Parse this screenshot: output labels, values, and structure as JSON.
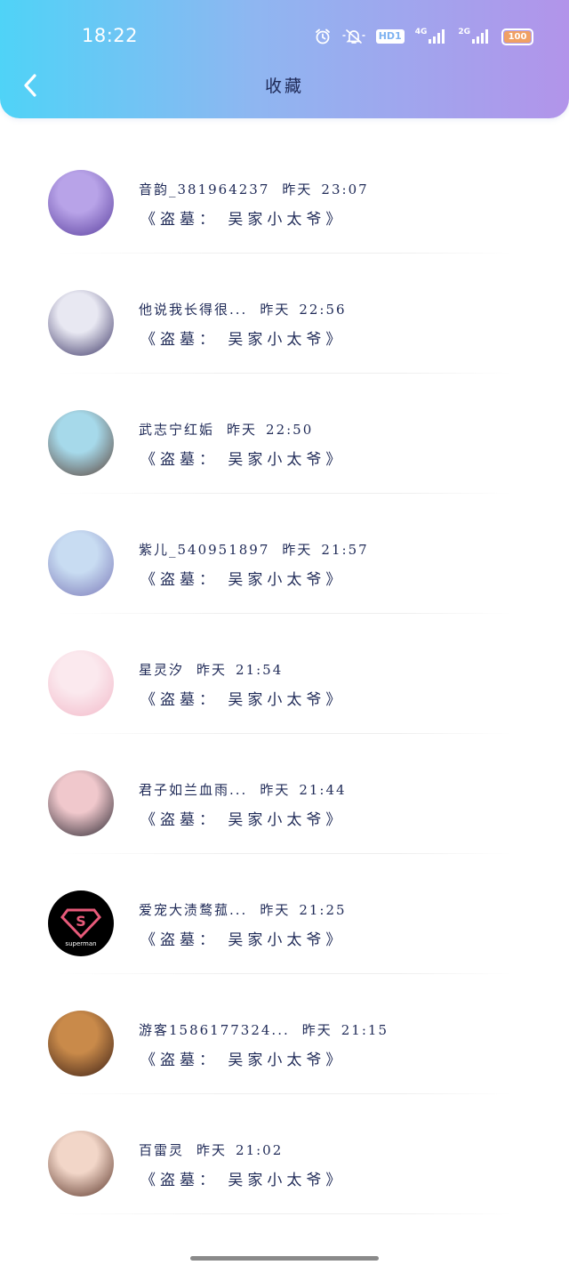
{
  "status_bar": {
    "time": "18:22",
    "hd_label": "HD1",
    "signal1_label": "4G",
    "signal2_label": "2G",
    "battery_level": "100"
  },
  "nav": {
    "title": "收藏"
  },
  "items": [
    {
      "name": "音韵_381964237",
      "date": "昨天",
      "time": "23:07",
      "subtitle": "《盗墓： 吴家小太爷》",
      "avatar_colors": [
        "#b8a3e8",
        "#5a3f9e"
      ]
    },
    {
      "name": "他说我长得很...",
      "date": "昨天",
      "time": "22:56",
      "subtitle": "《盗墓： 吴家小太爷》",
      "avatar_colors": [
        "#e8e8f2",
        "#3b3566"
      ]
    },
    {
      "name": "武志宁红姤",
      "date": "昨天",
      "time": "22:50",
      "subtitle": "《盗墓： 吴家小太爷》",
      "avatar_colors": [
        "#a6d9ea",
        "#5a4238"
      ]
    },
    {
      "name": "紫儿_540951897",
      "date": "昨天",
      "time": "21:57",
      "subtitle": "《盗墓： 吴家小太爷》",
      "avatar_colors": [
        "#c8dcf2",
        "#7a78b8"
      ]
    },
    {
      "name": "星灵汐",
      "date": "昨天",
      "time": "21:54",
      "subtitle": "《盗墓： 吴家小太爷》",
      "avatar_colors": [
        "#fbe9ee",
        "#f2b8c8"
      ]
    },
    {
      "name": "君子如兰血雨...",
      "date": "昨天",
      "time": "21:44",
      "subtitle": "《盗墓： 吴家小太爷》",
      "avatar_colors": [
        "#f0c8cc",
        "#2a2630"
      ]
    },
    {
      "name": "爱宠大渍鹜菰...",
      "date": "昨天",
      "time": "21:25",
      "subtitle": "《盗墓： 吴家小太爷》",
      "avatar_colors": [
        "#000000",
        "#e85a7a"
      ],
      "avatar_text": "superman"
    },
    {
      "name": "游客1586177324...",
      "date": "昨天",
      "time": "21:15",
      "subtitle": "《盗墓： 吴家小太爷》",
      "avatar_colors": [
        "#c98a4a",
        "#3a1e14"
      ]
    },
    {
      "name": "百雷灵",
      "date": "昨天",
      "time": "21:02",
      "subtitle": "《盗墓： 吴家小太爷》",
      "avatar_colors": [
        "#f2d6c8",
        "#5a3428"
      ]
    }
  ],
  "colors": {
    "header_start": "#4fd3f7",
    "header_end": "#b294ea",
    "text_primary": "#1f2a57"
  }
}
